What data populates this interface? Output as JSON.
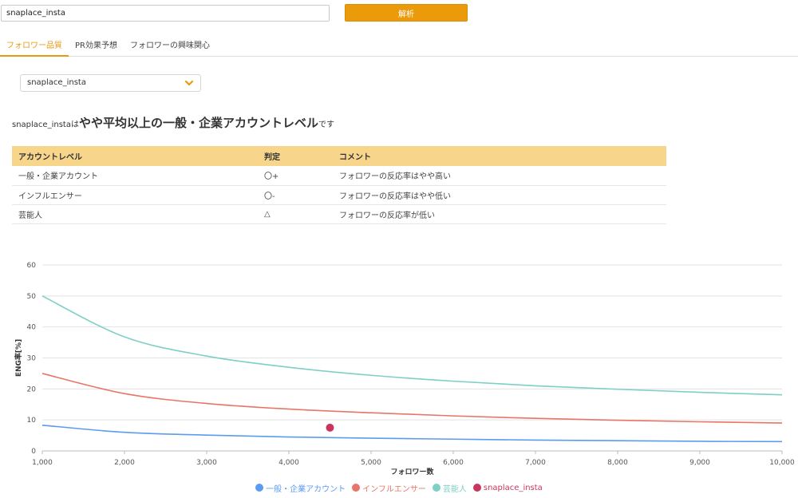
{
  "search": {
    "value": "snaplace_insta"
  },
  "analyze_button": {
    "label": "解析"
  },
  "tabs": [
    {
      "label": "フォロワー品質",
      "active": true
    },
    {
      "label": "PR効果予想",
      "active": false
    },
    {
      "label": "フォロワーの興味関心",
      "active": false
    }
  ],
  "account_select": {
    "selected": "snaplace_insta"
  },
  "headline": {
    "account": "snaplace_insta",
    "particle": "は",
    "level": "やや平均以上の一般・企業アカウントレベル",
    "suffix": "です"
  },
  "table": {
    "headers": [
      "アカウントレベル",
      "判定",
      "コメント"
    ],
    "rows": [
      [
        "一般・企業アカウント",
        "〇+",
        "フォロワーの反応率はやや高い"
      ],
      [
        "インフルエンサー",
        "〇-",
        "フォロワーの反応率はやや低い"
      ],
      [
        "芸能人",
        "△",
        "フォロワーの反応率が低い"
      ]
    ]
  },
  "colors": {
    "accent": "#ea9a0a",
    "table_header": "#f7d58b",
    "series_general": "#5b9bf0",
    "series_influencer": "#e87567",
    "series_celebrity": "#7ecfc6",
    "series_account": "#c8365e"
  },
  "chart_data": {
    "type": "line",
    "xlabel": "フォロワー数",
    "ylabel": "ENG率[%]",
    "xlim": [
      1000,
      10000
    ],
    "ylim": [
      0,
      60
    ],
    "x_ticks": [
      "1,000",
      "2,000",
      "3,000",
      "4,000",
      "5,000",
      "6,000",
      "7,000",
      "8,000",
      "9,000",
      "10,000"
    ],
    "y_ticks": [
      "0",
      "10",
      "20",
      "30",
      "40",
      "50",
      "60"
    ],
    "grid": true,
    "legend_position": "bottom",
    "x": [
      1000,
      2000,
      3000,
      4000,
      5000,
      6000,
      7000,
      8000,
      9000,
      10000
    ],
    "series": [
      {
        "name": "一般・企業アカウント",
        "color": "#5b9bf0",
        "values": [
          8.3,
          6.0,
          5.1,
          4.5,
          4.1,
          3.8,
          3.5,
          3.3,
          3.1,
          3.0
        ]
      },
      {
        "name": "インフルエンサー",
        "color": "#e87567",
        "values": [
          25.0,
          18.5,
          15.3,
          13.5,
          12.3,
          11.3,
          10.5,
          9.9,
          9.4,
          9.0
        ]
      },
      {
        "name": "芸能人",
        "color": "#7ecfc6",
        "values": [
          50.0,
          36.8,
          30.6,
          27.0,
          24.4,
          22.5,
          21.0,
          19.9,
          18.9,
          18.1
        ]
      }
    ],
    "points": [
      {
        "name": "snaplace_insta",
        "color": "#c8365e",
        "x": 4500,
        "y": 7.5
      }
    ]
  }
}
